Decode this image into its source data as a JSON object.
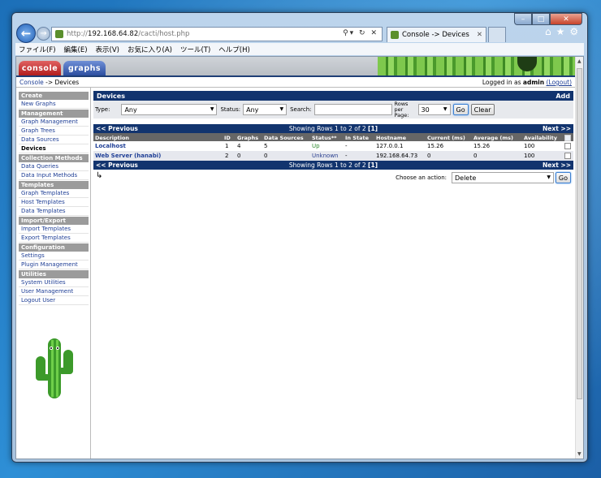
{
  "browser": {
    "url_prefix": "http://",
    "url_host": "192.168.64.82",
    "url_path": "/cacti/host.php",
    "tab_title": "Console -> Devices",
    "menu": [
      "ファイル(F)",
      "編集(E)",
      "表示(V)",
      "お気に入り(A)",
      "ツール(T)",
      "ヘルプ(H)"
    ]
  },
  "header": {
    "tabs": [
      "console",
      "graphs"
    ],
    "breadcrumb_link": "Console",
    "breadcrumb_current": "-> Devices",
    "login_prefix": "Logged in as",
    "login_user": "admin",
    "logout_label": "(Logout)"
  },
  "sidebar": [
    {
      "type": "header",
      "label": "Create"
    },
    {
      "type": "item",
      "label": "New Graphs"
    },
    {
      "type": "header",
      "label": "Management"
    },
    {
      "type": "item",
      "label": "Graph Management"
    },
    {
      "type": "item",
      "label": "Graph Trees"
    },
    {
      "type": "item",
      "label": "Data Sources"
    },
    {
      "type": "item",
      "label": "Devices",
      "active": true
    },
    {
      "type": "header",
      "label": "Collection Methods"
    },
    {
      "type": "item",
      "label": "Data Queries"
    },
    {
      "type": "item",
      "label": "Data Input Methods"
    },
    {
      "type": "header",
      "label": "Templates"
    },
    {
      "type": "item",
      "label": "Graph Templates"
    },
    {
      "type": "item",
      "label": "Host Templates"
    },
    {
      "type": "item",
      "label": "Data Templates"
    },
    {
      "type": "header",
      "label": "Import/Export"
    },
    {
      "type": "item",
      "label": "Import Templates"
    },
    {
      "type": "item",
      "label": "Export Templates"
    },
    {
      "type": "header",
      "label": "Configuration"
    },
    {
      "type": "item",
      "label": "Settings"
    },
    {
      "type": "item",
      "label": "Plugin Management"
    },
    {
      "type": "header",
      "label": "Utilities"
    },
    {
      "type": "item",
      "label": "System Utilities"
    },
    {
      "type": "item",
      "label": "User Management"
    },
    {
      "type": "item",
      "label": "Logout User"
    }
  ],
  "devices": {
    "title": "Devices",
    "add_label": "Add",
    "filter": {
      "type_label": "Type:",
      "type_value": "Any",
      "status_label": "Status:",
      "status_value": "Any",
      "search_label": "Search:",
      "search_value": "",
      "rows_label_1": "Rows",
      "rows_label_2": "per",
      "rows_label_3": "Page:",
      "rows_value": "30",
      "go_label": "Go",
      "clear_label": "Clear"
    },
    "pager": {
      "prev": "<< Previous",
      "showing": "Showing Rows 1 to 2 of 2",
      "page": "[1]",
      "next": "Next >>"
    },
    "columns": [
      "Description",
      "ID",
      "Graphs",
      "Data Sources",
      "Status**",
      "In State",
      "Hostname",
      "Current (ms)",
      "Average (ms)",
      "Availability"
    ],
    "rows": [
      {
        "description": "Localhost",
        "id": "1",
        "graphs": "4",
        "data_sources": "5",
        "status": "Up",
        "in_state": "-",
        "hostname": "127.0.0.1",
        "current": "15.26",
        "average": "15.26",
        "availability": "100"
      },
      {
        "description": "Web Server (hanabi)",
        "id": "2",
        "graphs": "0",
        "data_sources": "0",
        "status": "Unknown",
        "in_state": "-",
        "hostname": "192.168.64.73",
        "current": "0",
        "average": "0",
        "availability": "100"
      }
    ],
    "action": {
      "label": "Choose an action:",
      "value": "Delete",
      "go_label": "Go"
    }
  }
}
